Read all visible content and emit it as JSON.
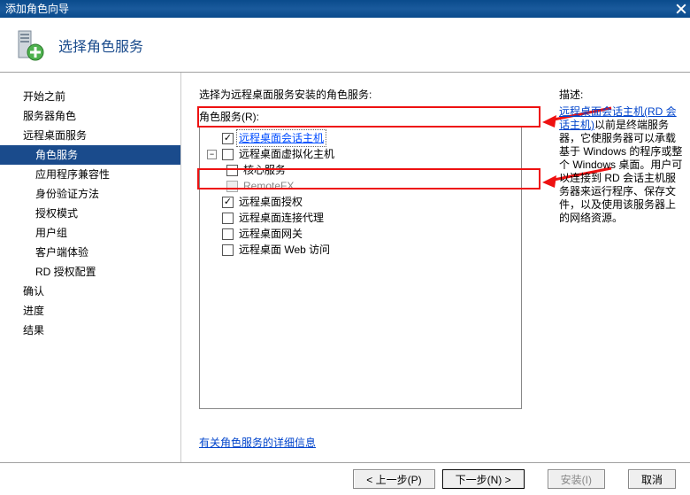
{
  "window": {
    "title": "添加角色向导"
  },
  "header": {
    "title": "选择角色服务"
  },
  "sidebar": {
    "items": [
      {
        "label": "开始之前",
        "sub": false
      },
      {
        "label": "服务器角色",
        "sub": false
      },
      {
        "label": "远程桌面服务",
        "sub": false
      },
      {
        "label": "角色服务",
        "sub": true,
        "selected": true
      },
      {
        "label": "应用程序兼容性",
        "sub": true
      },
      {
        "label": "身份验证方法",
        "sub": true
      },
      {
        "label": "授权模式",
        "sub": true
      },
      {
        "label": "用户组",
        "sub": true
      },
      {
        "label": "客户端体验",
        "sub": true
      },
      {
        "label": "RD 授权配置",
        "sub": true
      },
      {
        "label": "确认",
        "sub": false
      },
      {
        "label": "进度",
        "sub": false
      },
      {
        "label": "结果",
        "sub": false
      }
    ]
  },
  "main": {
    "intro": "选择为远程桌面服务安装的角色服务:",
    "label_services": "角色服务(R):",
    "tree": [
      {
        "label": "远程桌面会话主机",
        "level": 1,
        "checked": true,
        "focus": true,
        "expand": null
      },
      {
        "label": "远程桌面虚拟化主机",
        "level": 1,
        "checked": false,
        "expand": "minus"
      },
      {
        "label": "核心服务",
        "level": 2,
        "checked": false
      },
      {
        "label": "RemoteFX",
        "level": 2,
        "checked": false,
        "disabled": true
      },
      {
        "label": "远程桌面授权",
        "level": 1,
        "checked": true,
        "expand": null
      },
      {
        "label": "远程桌面连接代理",
        "level": 1,
        "checked": false
      },
      {
        "label": "远程桌面网关",
        "level": 1,
        "checked": false
      },
      {
        "label": "远程桌面 Web 访问",
        "level": 1,
        "checked": false
      }
    ],
    "learn_link": "有关角色服务的详细信息"
  },
  "desc": {
    "title": "描述:",
    "link": "远程桌面会话主机(RD 会话主机)",
    "body": "以前是终端服务器，它使服务器可以承载基于 Windows 的程序或整个 Windows 桌面。用户可以连接到 RD 会话主机服务器来运行程序、保存文件，以及使用该服务器上的网络资源。"
  },
  "footer": {
    "prev": "< 上一步(P)",
    "next": "下一步(N) >",
    "install": "安装(I)",
    "cancel": "取消"
  }
}
